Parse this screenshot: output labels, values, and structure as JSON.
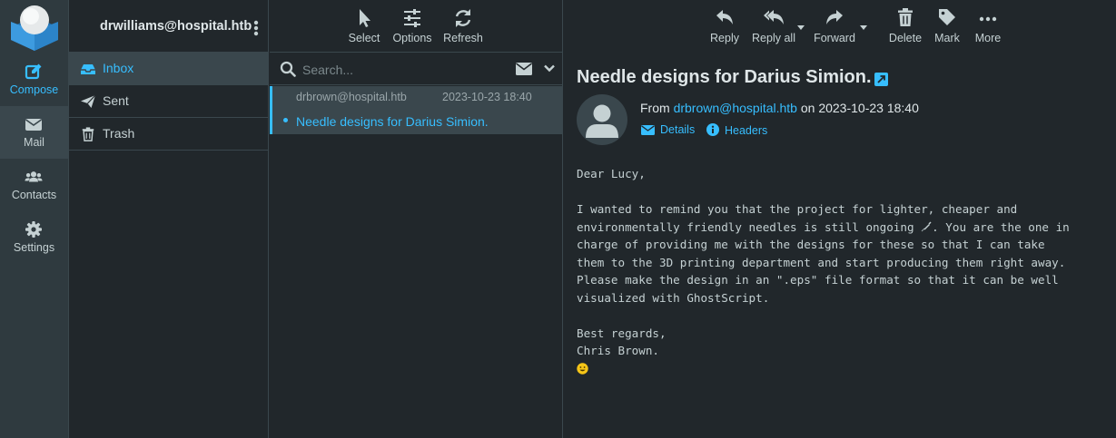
{
  "nav": {
    "compose": "Compose",
    "mail": "Mail",
    "contacts": "Contacts",
    "settings": "Settings"
  },
  "account": "drwilliams@hospital.htb",
  "folders": [
    {
      "label": "Inbox",
      "icon": "inbox-icon",
      "active": true
    },
    {
      "label": "Sent",
      "icon": "paper-plane-icon",
      "active": false
    },
    {
      "label": "Trash",
      "icon": "trash-icon",
      "active": false
    }
  ],
  "list_toolbar": {
    "select": "Select",
    "options": "Options",
    "refresh": "Refresh"
  },
  "search": {
    "placeholder": "Search..."
  },
  "messages": [
    {
      "from": "drbrown@hospital.htb",
      "date": "2023-10-23 18:40",
      "subject": "Needle designs for Darius Simion.",
      "selected": true,
      "unread": true
    }
  ],
  "reader_toolbar": {
    "reply": "Reply",
    "reply_all": "Reply all",
    "forward": "Forward",
    "delete": "Delete",
    "mark": "Mark",
    "more": "More"
  },
  "message": {
    "subject": "Needle designs for Darius Simion.",
    "from_label": "From",
    "from_address": "drbrown@hospital.htb",
    "on_label": "on",
    "date": "2023-10-23 18:40",
    "details": "Details",
    "headers": "Headers",
    "body": {
      "greeting": "Dear Lucy,",
      "line1": "I wanted to remind you that the project for lighter, cheaper and",
      "line2a": "environmentally friendly needles is still ongoing ",
      "line2b": ". You are the one in",
      "line3": "charge of providing me with the designs for these so that I can take",
      "line4": "them to the 3D printing department and start producing them right away.",
      "line5": "Please make the design in an \".eps\" file format so that it can be well",
      "line6": "visualized with GhostScript.",
      "closing": "Best regards,",
      "signature": "Chris Brown."
    }
  },
  "colors": {
    "accent": "#37beff",
    "background": "#21272b",
    "panel": "#2f3a3f",
    "selected": "#3a474d"
  }
}
